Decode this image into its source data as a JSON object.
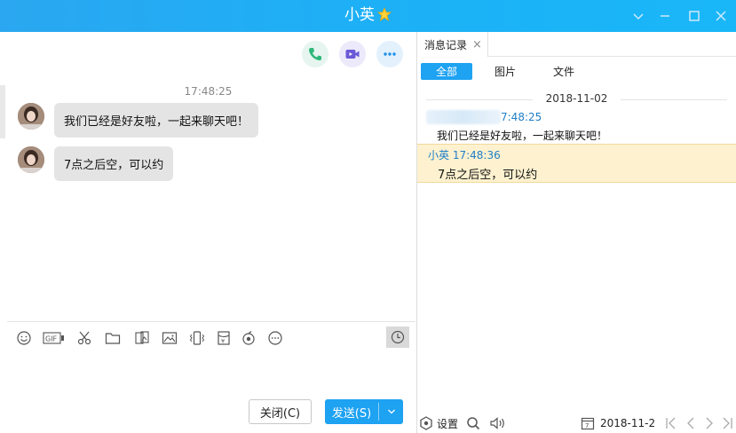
{
  "window": {
    "title": "小英",
    "minimize": "minimize",
    "maximize": "maximize",
    "close": "close",
    "dropdown": "dropdown"
  },
  "chat": {
    "actions": [
      "phone-call",
      "video-call",
      "more"
    ],
    "timestamp": "17:48:25",
    "messages": [
      {
        "text": "我们已经是好友啦，一起来聊天吧！"
      },
      {
        "text": "7点之后空，可以约"
      }
    ],
    "toolbar": [
      "emoji",
      "gif",
      "screenshot",
      "folder",
      "image-gallery",
      "image",
      "shake",
      "red-packet",
      "music",
      "more",
      "history"
    ],
    "close_button": "关闭(C)",
    "send_button": "发送(S)"
  },
  "history": {
    "tab_label": "消息记录",
    "tab_close": "×",
    "filters": [
      "全部",
      "图片",
      "文件"
    ],
    "active_filter": 0,
    "date": "2018-11-02",
    "records": [
      {
        "sender": "",
        "time": "7:48:25",
        "text": "我们已经是好友啦，一起来聊天吧！"
      },
      {
        "sender": "小英",
        "time": "17:48:36",
        "text": "7点之后空，可以约"
      }
    ],
    "footer": {
      "settings_label": "设置",
      "date_value": "2018-11-2"
    }
  },
  "colors": {
    "titlebar": "#1db0f6",
    "accent": "#1ea2f2",
    "highlight": "#fdf1cf",
    "bubble": "#e4e4e4"
  }
}
